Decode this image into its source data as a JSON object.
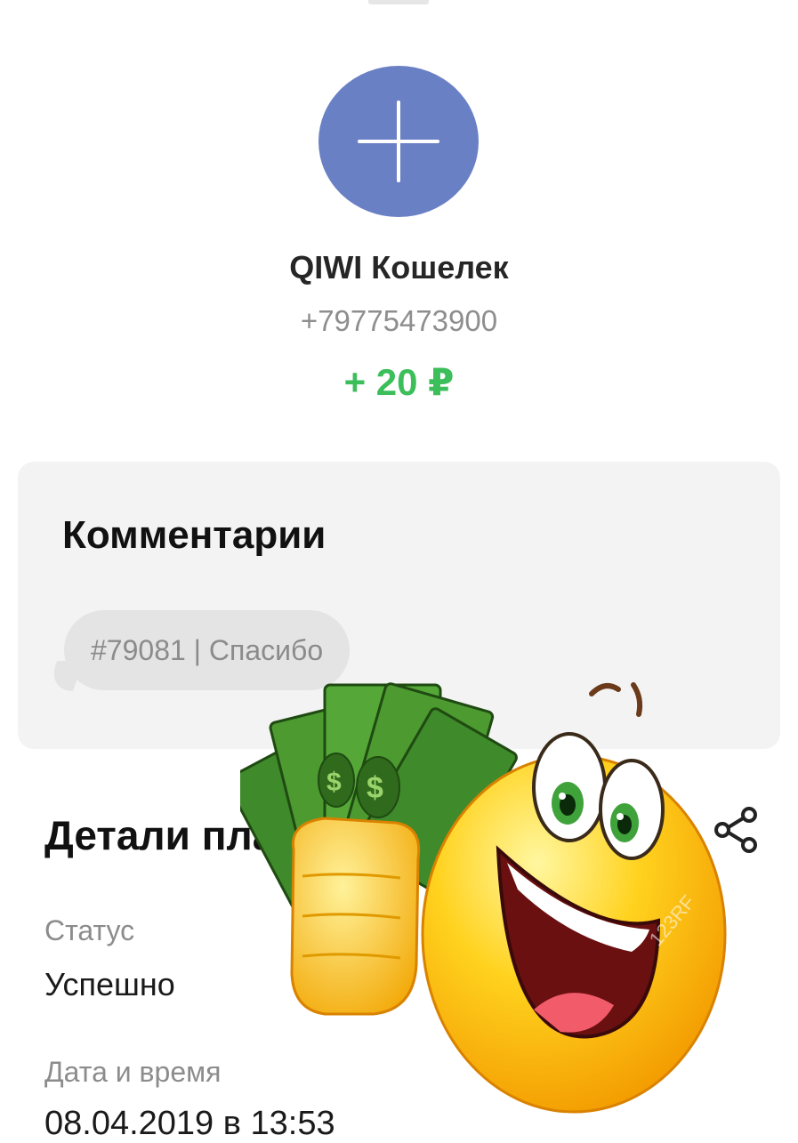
{
  "provider": {
    "name": "QIWI Кошелек",
    "account": "+79775473900",
    "amount": "+ 20 ₽",
    "avatar_icon": "plus-icon"
  },
  "comments": {
    "title": "Комментарии",
    "items": [
      "#79081 | Спасибо"
    ]
  },
  "details": {
    "title": "Детали платежа",
    "share_icon": "share-icon",
    "status_label": "Статус",
    "status_value": "Успешно",
    "date_label": "Дата и время",
    "date_value": "08.04.2019 в 13:53"
  },
  "sticker": {
    "icon": "emoji-with-money",
    "watermark": "123RF"
  },
  "colors": {
    "avatar": "#6a80c4",
    "amount": "#3cbe5a",
    "card": "#f3f3f3",
    "bubble": "#e4e4e4"
  }
}
